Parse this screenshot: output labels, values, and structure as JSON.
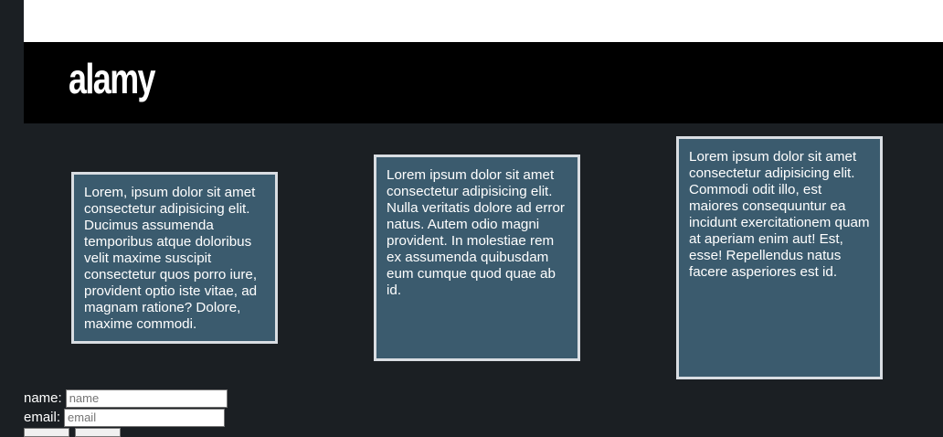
{
  "header": {
    "logo_text": "alamy"
  },
  "cards": [
    {
      "text": "Lorem, ipsum dolor sit amet consectetur adipisicing elit. Ducimus assumenda temporibus atque doloribus velit maxime suscipit consectetur quos porro iure, provident optio iste vitae, ad magnam ratione? Dolore, maxime commodi."
    },
    {
      "text": "Lorem ipsum dolor sit amet consectetur adipisicing elit. Nulla veritatis dolore ad error natus. Autem odio magni provident. In molestiae rem ex assumenda quibusdam eum cumque quod quae ab id."
    },
    {
      "text": "Lorem ipsum dolor sit amet consectetur adipisicing elit. Commodi odit illo, est maiores consequuntur ea incidunt exercitationem quam at aperiam enim aut! Est, esse! Repellendus natus facere asperiores est id."
    }
  ],
  "form": {
    "name_label": "name:",
    "name_placeholder": "name",
    "email_label": "email:",
    "email_placeholder": "email"
  },
  "colors": {
    "page_background": "#1b1f23",
    "header_background": "#000000",
    "card_background": "#3b5b6e",
    "card_border": "#d9dde2"
  }
}
